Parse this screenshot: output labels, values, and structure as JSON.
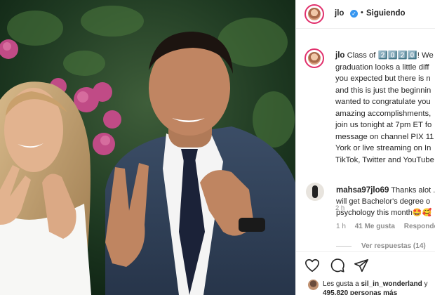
{
  "header": {
    "username": "jlo",
    "separator": "•",
    "follow_label": "Siguiendo"
  },
  "caption": {
    "username": "jlo",
    "lines": [
      "Class of 2️⃣0️⃣2️⃣0️⃣! We",
      "graduation looks a little diff",
      "you expected but there is n",
      "and this is just the beginnin",
      "wanted to congratulate you",
      "amazing accomplishments,",
      "join us tonight at 7pm ET fo",
      "message on channel PIX 11",
      "York or live streaming on In",
      "TikTok, Twitter and YouTube"
    ],
    "time": "2 h"
  },
  "comment": {
    "username": "mahsa97jlo69",
    "lines": [
      "Thanks alot .",
      "will get Bachelor's degree o",
      "psychology this month🤩🥰"
    ],
    "time": "1 h",
    "likes": "41 Me gusta",
    "reply": "Responder",
    "view_replies": "Ver respuestas (14)"
  },
  "actions": {
    "like_icon": "heart-icon",
    "comment_icon": "comment-icon",
    "share_icon": "share-icon"
  },
  "likes": {
    "prefix": "Les gusta a ",
    "user": "sil_in_wonderland",
    "suffix": " y",
    "count": "495.820 personas más"
  },
  "colors": {
    "accent_ring": "#e1306c",
    "verified": "#3897f0",
    "muted": "#8e8e8e"
  }
}
